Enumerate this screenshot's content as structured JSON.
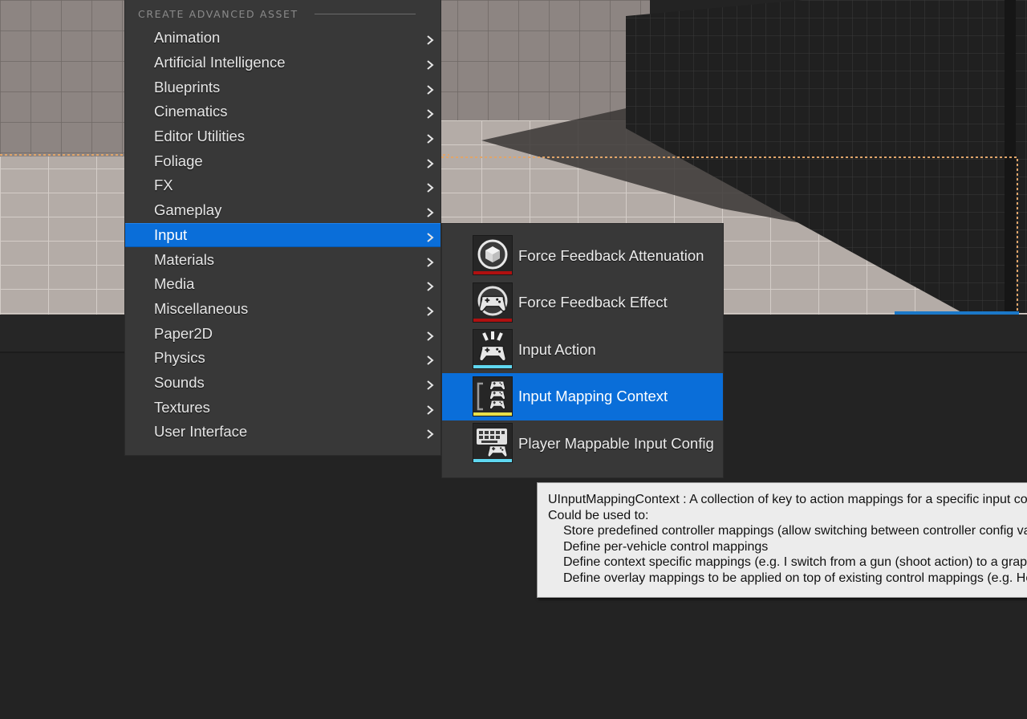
{
  "menu": {
    "section_title": "CREATE ADVANCED ASSET",
    "items": [
      {
        "label": "Animation"
      },
      {
        "label": "Artificial Intelligence"
      },
      {
        "label": "Blueprints"
      },
      {
        "label": "Cinematics"
      },
      {
        "label": "Editor Utilities"
      },
      {
        "label": "Foliage"
      },
      {
        "label": "FX"
      },
      {
        "label": "Gameplay"
      },
      {
        "label": "Input",
        "active": true
      },
      {
        "label": "Materials"
      },
      {
        "label": "Media"
      },
      {
        "label": "Miscellaneous"
      },
      {
        "label": "Paper2D"
      },
      {
        "label": "Physics"
      },
      {
        "label": "Sounds"
      },
      {
        "label": "Textures"
      },
      {
        "label": "User Interface"
      }
    ],
    "chevron_icon": "chevron-right-icon"
  },
  "submenu": {
    "items": [
      {
        "label": "Force Feedback Attenuation",
        "icon": "force-feedback-attenuation-icon",
        "accent_color": "#b01010"
      },
      {
        "label": "Force Feedback Effect",
        "icon": "gamepad-wheel-icon",
        "accent_color": "#b01010"
      },
      {
        "label": "Input Action",
        "icon": "input-action-icon",
        "accent_color": "#5fd7f0"
      },
      {
        "label": "Input Mapping Context",
        "icon": "input-mapping-context-icon",
        "accent_color": "#e8e04a",
        "active": true
      },
      {
        "label": "Player Mappable Input Config",
        "icon": "keyboard-gamepad-icon",
        "accent_color": "#5fd7f0"
      }
    ]
  },
  "tooltip": {
    "lines": [
      "UInputMappingContext : A collection of key to action mappings for a specific input context",
      "Could be used to:",
      "Store predefined controller mappings (allow switching between controller config variants)",
      "Define per-vehicle control mappings",
      "Define context specific mappings (e.g. I switch from a gun (shoot action) to a grappling hook (reel in, reel out, disconnect actions)",
      "Define overlay mappings to be applied on top of existing control mappings (e.g. Hero specific action mappings in a MOBA)"
    ]
  },
  "colors": {
    "menu_bg": "#383838",
    "highlight": "#0a6ed9",
    "tooltip_bg": "#ececec"
  }
}
